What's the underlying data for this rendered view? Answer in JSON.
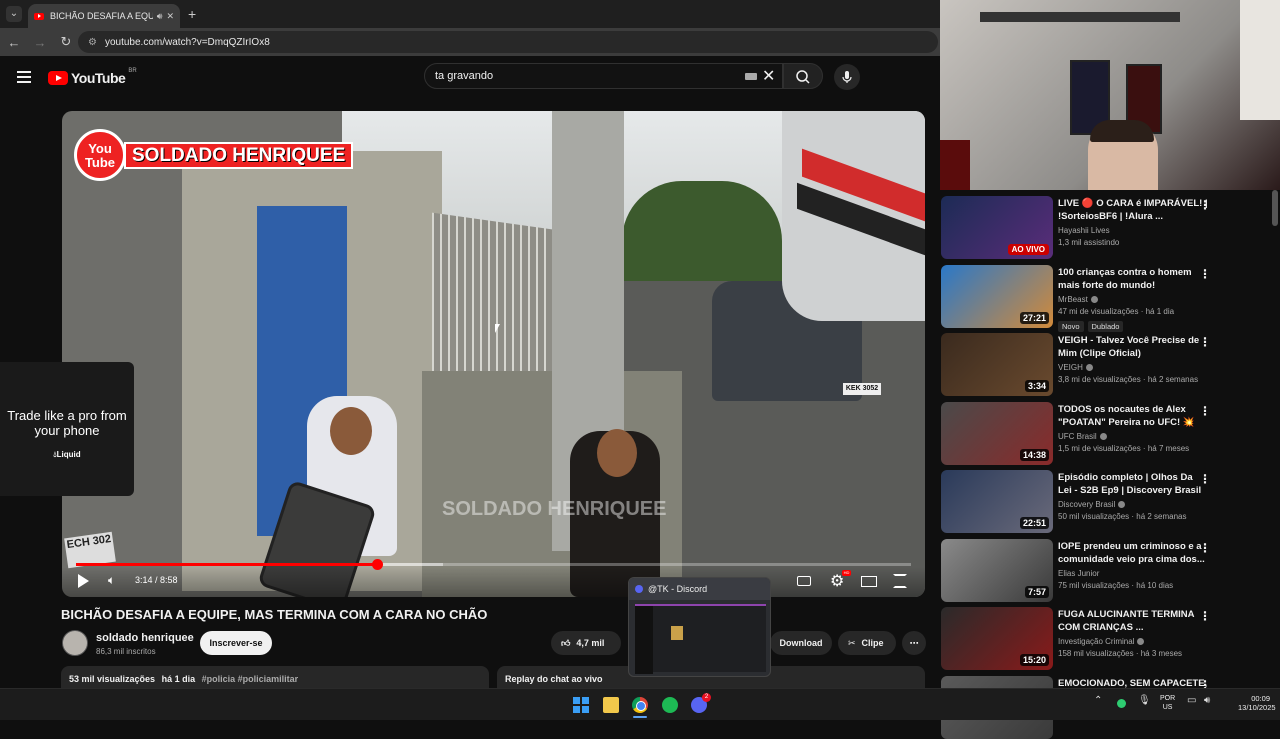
{
  "browser": {
    "tab_title": "BICHÃO DESAFIA A EQUIPE",
    "new_tab": "+",
    "url": "youtube.com/watch?v=DmqQZIrIOx8"
  },
  "youtube": {
    "logo": "YouTube",
    "region": "BR",
    "search_value": "ta gravando"
  },
  "player": {
    "channel_logo_badge": "You Tube",
    "channel_logo_name": "SOLDADO HENRIQUEE",
    "watermark": "SOLDADO HENRIQUEE",
    "plate_car": "KEK 3052",
    "plate_moto": "ECH 302",
    "time": "3:14 / 8:58",
    "progress_fraction": 0.36,
    "buffer_fraction": 0.44,
    "hd_badge": "HD"
  },
  "ad": {
    "text": "Trade like a pro from your phone",
    "brand": "Liquid"
  },
  "video": {
    "title": "BICHÃO DESAFIA A EQUIPE, MAS TERMINA COM A CARA NO CHÃO",
    "channel": "soldado henriquee",
    "subscribers": "86,3 mil inscritos",
    "subscribe_label": "Inscrever-se",
    "likes": "4,7 mil",
    "download_label": "Download",
    "clip_label": "Clipe",
    "views": "53 mil visualizações",
    "age": "há 1 dia",
    "tags": "#policia #policiamilitar",
    "chat_replay": "Replay do chat ao vivo"
  },
  "discord_preview": {
    "title": "@TK - Discord"
  },
  "recommendations": [
    {
      "title": "LIVE 🔴 O CARA é IMPARÁVEL! | !SorteiosBF6 | !Alura ...",
      "channel": "Hayashii Lives",
      "meta": "1,3 mil assistindo",
      "badge": "AO VIVO",
      "live": true,
      "verified": false,
      "thumb": [
        "#1c2b55",
        "#5a2d7a"
      ]
    },
    {
      "title": "100 crianças contra o homem mais forte do mundo!",
      "channel": "MrBeast",
      "meta": "47 mi de visualizações · há 1 dia",
      "badge": "27:21",
      "live": false,
      "verified": true,
      "tags": [
        "Novo",
        "Dublado"
      ],
      "thumb": [
        "#2a78c8",
        "#d28a3a"
      ]
    },
    {
      "title": "VEIGH - Talvez Você Precise de Mim (Clipe Oficial)",
      "channel": "VEIGH",
      "meta": "3,8 mi de visualizações · há 2 semanas",
      "badge": "3:34",
      "live": false,
      "verified": true,
      "thumb": [
        "#3a2a1e",
        "#6a4a2e"
      ]
    },
    {
      "title": "TODOS os nocautes de Alex \"POATAN\" Pereira no UFC! 💥",
      "channel": "UFC Brasil",
      "meta": "1,5 mi de visualizações · há 7 meses",
      "badge": "14:38",
      "live": false,
      "verified": true,
      "thumb": [
        "#4a4a4a",
        "#8a2a2a"
      ]
    },
    {
      "title": "Episódio completo | Olhos Da Lei - S2B Ep9 | Discovery Brasil",
      "channel": "Discovery Brasil",
      "meta": "50 mil visualizações · há 2 semanas",
      "badge": "22:51",
      "live": false,
      "verified": true,
      "thumb": [
        "#2a3a5a",
        "#6a6a7a"
      ]
    },
    {
      "title": "IOPE prendeu um criminoso e a comunidade veio pra cima dos...",
      "channel": "Elias Junior",
      "meta": "75 mil visualizações · há 10 dias",
      "badge": "7:57",
      "live": false,
      "verified": false,
      "thumb": [
        "#8a8a8a",
        "#3a3a3a"
      ]
    },
    {
      "title": "FUGA ALUCINANTE TERMINA COM CRIANÇAS ...",
      "channel": "Investigação Criminal",
      "meta": "158 mil visualizações · há 3 meses",
      "badge": "15:20",
      "live": false,
      "verified": true,
      "thumb": [
        "#2a2a2a",
        "#8a1a1a"
      ]
    },
    {
      "title": "EMOCIONADO, SEM CAPACETE,",
      "channel": "",
      "meta": "",
      "badge": "",
      "live": false,
      "verified": false,
      "thumb": [
        "#5a5a5a",
        "#3a3a3a"
      ]
    }
  ],
  "taskbar": {
    "lang_1": "POR",
    "lang_2": "US",
    "time": "00:09",
    "date": "13/10/2025",
    "discord_badge": "2"
  }
}
